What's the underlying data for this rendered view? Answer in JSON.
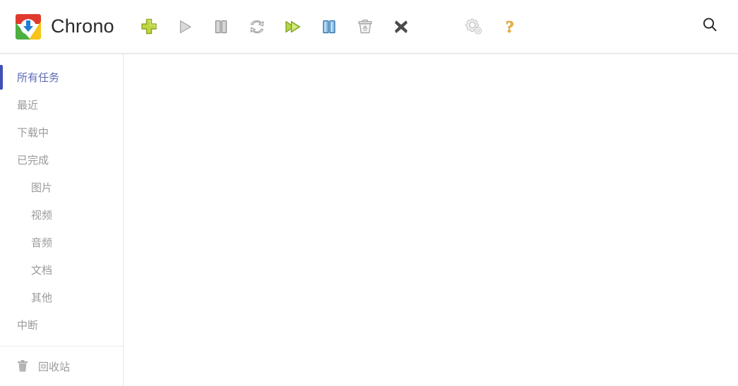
{
  "app": {
    "title": "Chrono",
    "logo_icon": "chrome-download-logo"
  },
  "colors": {
    "accent": "#3f51b5",
    "active_text": "#5b6ab5",
    "nav_text": "#9a9a9a",
    "title_text": "#2b2b2b",
    "border": "#e6e6e6",
    "green": "#aacc33",
    "green_dark": "#7d9e1e",
    "blue": "#5b9bd5",
    "gray_icon": "#b3b3b3",
    "dark_x": "#4a4a4a",
    "help_orange": "#e8a33d"
  },
  "toolbar": {
    "buttons": [
      {
        "name": "add-task-button",
        "label": "新建任务",
        "icon": "plus-icon"
      },
      {
        "name": "start-button",
        "label": "开始",
        "icon": "play-icon"
      },
      {
        "name": "pause-button",
        "label": "暂停",
        "icon": "pause-icon"
      },
      {
        "name": "resume-button",
        "label": "重新下载",
        "icon": "refresh-icon"
      },
      {
        "name": "start-all-button",
        "label": "全部开始",
        "icon": "fast-forward-icon"
      },
      {
        "name": "pause-all-button",
        "label": "全部暂停",
        "icon": "pause-all-icon"
      },
      {
        "name": "recycle-button",
        "label": "回收站",
        "icon": "recycle-bin-icon"
      },
      {
        "name": "delete-button",
        "label": "删除",
        "icon": "close-x-icon"
      },
      {
        "name": "settings-button",
        "label": "设置",
        "icon": "gear-icon"
      },
      {
        "name": "help-button",
        "label": "帮助",
        "icon": "question-mark-icon"
      }
    ],
    "search": {
      "name": "search-button",
      "label": "搜索",
      "icon": "search-icon"
    }
  },
  "sidebar": {
    "items": [
      {
        "label": "所有任务",
        "active": true,
        "indent": false,
        "name": "sidebar-item-all-tasks"
      },
      {
        "label": "最近",
        "active": false,
        "indent": false,
        "name": "sidebar-item-recent"
      },
      {
        "label": "下载中",
        "active": false,
        "indent": false,
        "name": "sidebar-item-downloading"
      },
      {
        "label": "已完成",
        "active": false,
        "indent": false,
        "name": "sidebar-item-completed"
      },
      {
        "label": "图片",
        "active": false,
        "indent": true,
        "name": "sidebar-item-images"
      },
      {
        "label": "视频",
        "active": false,
        "indent": true,
        "name": "sidebar-item-videos"
      },
      {
        "label": "音频",
        "active": false,
        "indent": true,
        "name": "sidebar-item-audio"
      },
      {
        "label": "文档",
        "active": false,
        "indent": true,
        "name": "sidebar-item-documents"
      },
      {
        "label": "其他",
        "active": false,
        "indent": true,
        "name": "sidebar-item-others"
      },
      {
        "label": "中断",
        "active": false,
        "indent": false,
        "name": "sidebar-item-interrupted"
      }
    ],
    "trash": {
      "label": "回收站",
      "icon": "trash-icon",
      "name": "sidebar-item-recycle-bin"
    }
  },
  "main": {
    "empty": ""
  }
}
